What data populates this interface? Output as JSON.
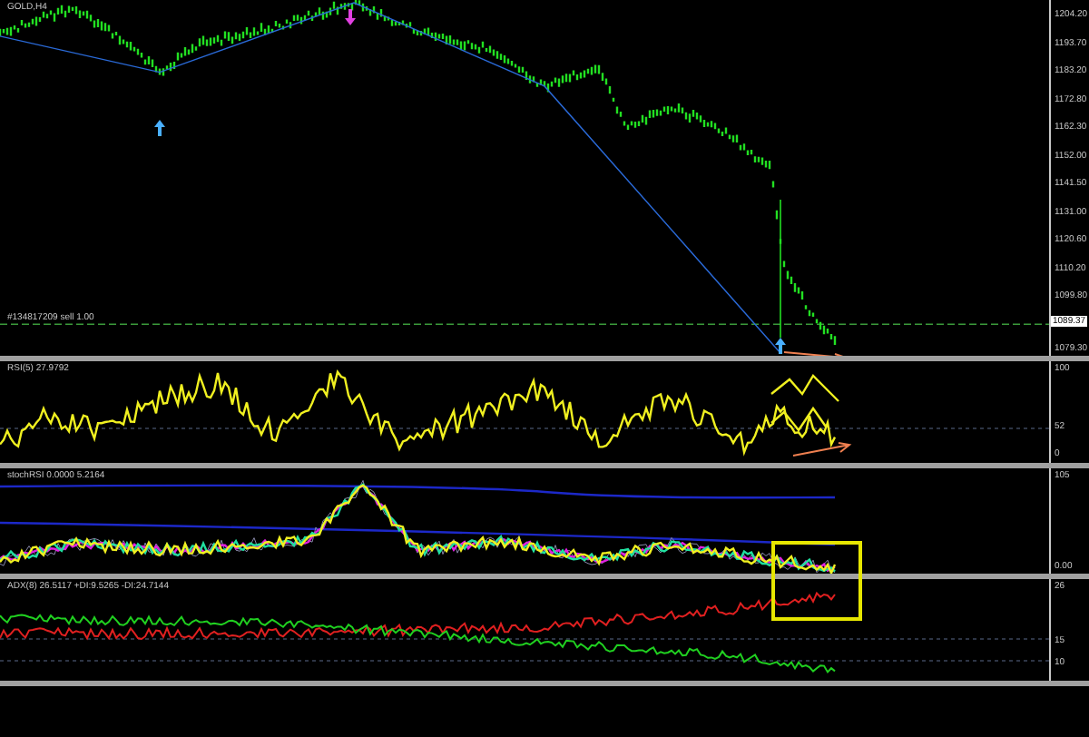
{
  "main_chart": {
    "symbol_label": "GOLD,H4",
    "order_label": "#134817209 sell 1.00",
    "current_price": "1089.37",
    "price_axis": [
      "1204.20",
      "1193.70",
      "1183.20",
      "1172.80",
      "1162.30",
      "1152.00",
      "1141.50",
      "1131.00",
      "1120.60",
      "1110.20",
      "1099.80",
      "1079.30"
    ]
  },
  "rsi_panel": {
    "label": "RSI(5) 27.9792",
    "axis": [
      "100",
      "52",
      "0"
    ]
  },
  "stoch_panel": {
    "label": "stochRSI 0.0000 5.2164",
    "axis": [
      "105",
      "0.00"
    ]
  },
  "adx_panel": {
    "label": "ADX(8) 26.5117 +DI:9.5265 -DI:24.7144",
    "axis": [
      "26",
      "15",
      "10"
    ]
  }
}
